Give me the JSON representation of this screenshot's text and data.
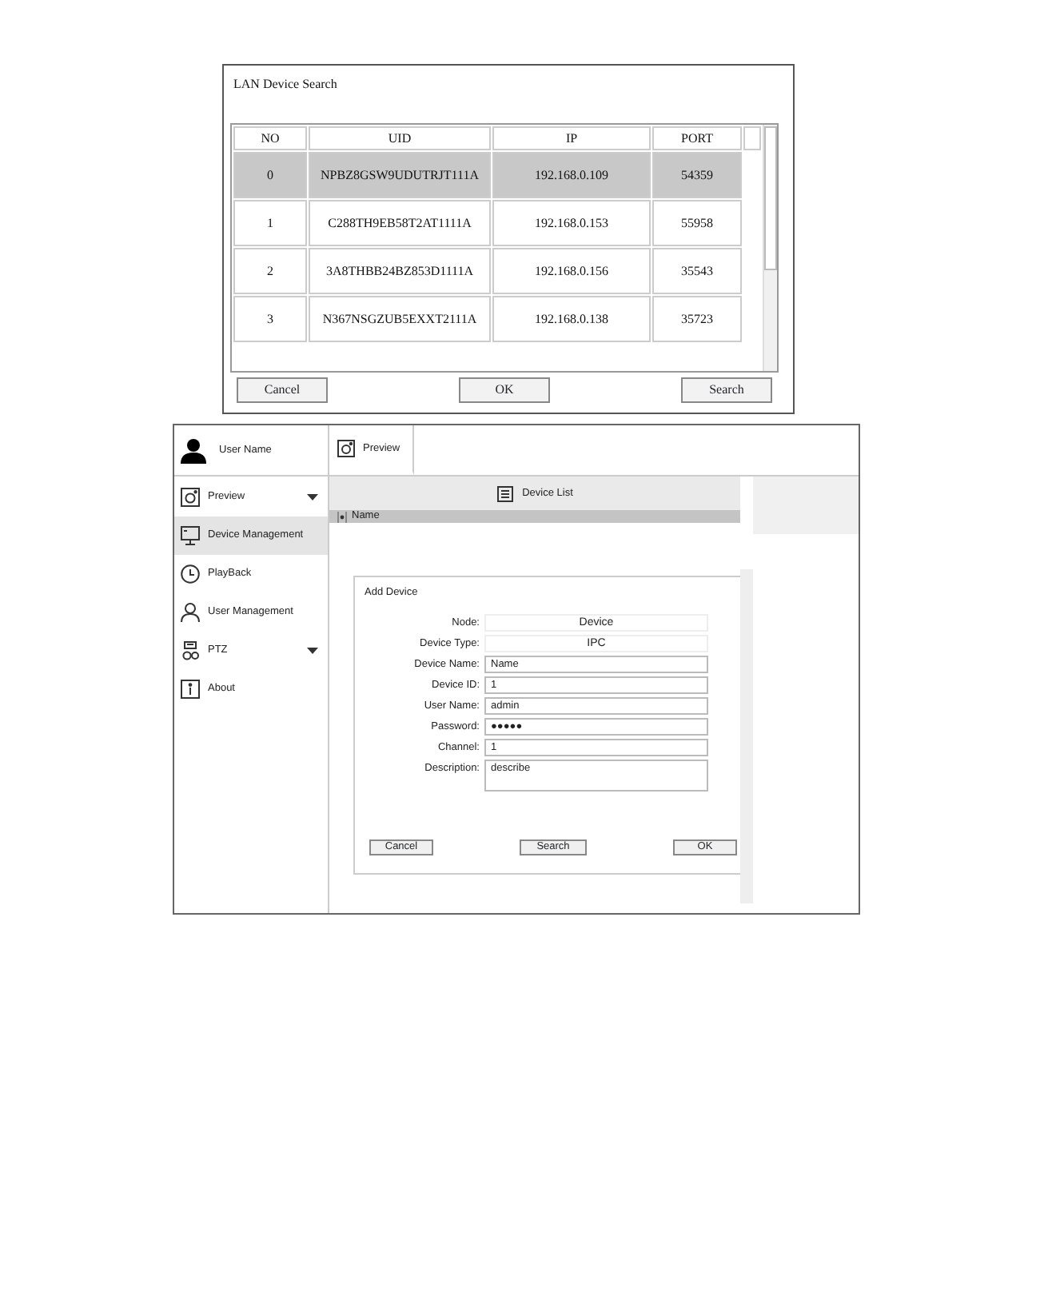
{
  "search_dialog": {
    "title": "LAN Device Search",
    "columns": [
      "NO",
      "UID",
      "IP",
      "PORT"
    ],
    "rows": [
      {
        "no": "0",
        "uid": "NPBZ8GSW9UDUTRJT111A",
        "ip": "192.168.0.109",
        "port": "54359",
        "selected": true
      },
      {
        "no": "1",
        "uid": "C288TH9EB58T2AT1111A",
        "ip": "192.168.0.153",
        "port": "55958",
        "selected": false
      },
      {
        "no": "2",
        "uid": "3A8THBB24BZ853D1111A",
        "ip": "192.168.0.156",
        "port": "35543",
        "selected": false
      },
      {
        "no": "3",
        "uid": "N367NSGZUB5EXXT2111A",
        "ip": "192.168.0.138",
        "port": "35723",
        "selected": false
      }
    ],
    "buttons": [
      "Cancel",
      "OK",
      "Search"
    ]
  },
  "app": {
    "user": {
      "name": "User Name"
    },
    "tabs": [
      {
        "label": "Preview",
        "selected": true
      }
    ],
    "sidebar": {
      "items": [
        {
          "label": "Preview",
          "kind": "camera",
          "selected": false,
          "expandable": true
        },
        {
          "label": "Device Management",
          "kind": "monitor",
          "selected": true,
          "expandable": false
        },
        {
          "label": "PlayBack",
          "kind": "clock",
          "selected": false,
          "expandable": false
        },
        {
          "label": "User Management",
          "kind": "person",
          "selected": false,
          "expandable": false
        },
        {
          "label": "PTZ",
          "kind": "ptz",
          "selected": false,
          "expandable": true
        },
        {
          "label": "About",
          "kind": "info",
          "selected": false,
          "expandable": false
        }
      ]
    },
    "device_list": {
      "title": "Device List",
      "tree": [
        {
          "label": "Name",
          "selected": true
        }
      ]
    },
    "add_device": {
      "title": "Add Device",
      "fields": [
        {
          "label": "Node:",
          "value": "Device",
          "kind": "display"
        },
        {
          "label": "Device Type:",
          "value": "IPC",
          "kind": "display"
        },
        {
          "label": "Device Name:",
          "value": "Name",
          "kind": "input"
        },
        {
          "label": "Device ID:",
          "value": "1",
          "kind": "input"
        },
        {
          "label": "User Name:",
          "value": "admin",
          "kind": "input"
        },
        {
          "label": "Password:",
          "value": "●●●●●",
          "kind": "input"
        },
        {
          "label": "Channel:",
          "value": "1",
          "kind": "input"
        },
        {
          "label": "Description:",
          "value": "describe",
          "kind": "textarea"
        }
      ],
      "buttons": [
        "Cancel",
        "Search",
        "OK"
      ]
    }
  }
}
